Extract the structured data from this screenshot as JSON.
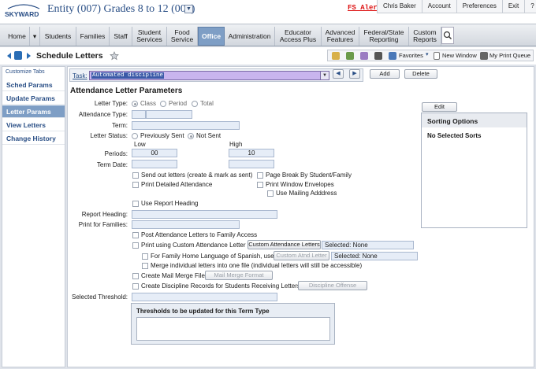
{
  "header": {
    "logo_text": "SKYWARD",
    "entity": "Entity (007) Grades 8 to 12 (007)",
    "fs_alert": "FS Alert",
    "user_links": [
      "Chris Baker",
      "Account",
      "Preferences",
      "Exit",
      "?"
    ]
  },
  "nav": {
    "items": [
      "Home",
      "Students",
      "Families",
      "Staff",
      "Student Services",
      "Food Service",
      "Office",
      "Administration",
      "Educator Access Plus",
      "Advanced Features",
      "Federal/State Reporting",
      "Custom Reports"
    ],
    "active": "Office"
  },
  "page": {
    "title": "Schedule Letters",
    "toolbar": {
      "favorites": "Favorites",
      "new_window": "New Window",
      "print_queue": "My Print Queue"
    }
  },
  "sidebar": {
    "customize": "Customize Tabs",
    "items": [
      "Sched Params",
      "Update Params",
      "Letter Params",
      "View Letters",
      "Change History"
    ],
    "active": "Letter Params"
  },
  "task": {
    "label": "Task:",
    "value": "Automated discipline",
    "add": "Add",
    "delete": "Delete"
  },
  "form": {
    "heading": "Attendance Letter Parameters",
    "letter_type_label": "Letter Type:",
    "letter_type_options": [
      "Class",
      "Period",
      "Total"
    ],
    "attendance_type_label": "Attendance Type:",
    "term_label": "Term:",
    "letter_status_label": "Letter Status:",
    "letter_status_options": [
      "Previously Sent",
      "Not Sent"
    ],
    "low_label": "Low",
    "high_label": "High",
    "periods_label": "Periods:",
    "periods_low": "00",
    "periods_high": "10",
    "term_date_label": "Term Date:",
    "send_out": "Send out letters (create & mark as sent)",
    "page_break": "Page Break By Student/Family",
    "print_detailed": "Print Detailed Attendance",
    "print_envelopes": "Print Window Envelopes",
    "use_mailing": "Use Mailing Adddress",
    "use_report_heading": "Use Report Heading",
    "report_heading_label": "Report Heading:",
    "print_for_families_label": "Print for Families:",
    "post_attendance": "Post Attendance Letters to Family Access",
    "print_custom": "Print using Custom Attendance Letter",
    "custom_btn": "Custom Attendance Letters",
    "custom_selected": "Selected: None",
    "spanish": "For Family Home Language of Spanish, use",
    "custom_atnd_btn": "Custom Atnd Letter",
    "spanish_selected": "Selected: None",
    "merge": "Merge individual letters into one file (individual letters will still be accessible)",
    "mail_merge": "Create Mail Merge File",
    "mail_merge_btn": "Mail Merge Format",
    "discipline": "Create Discipline Records for Students Receiving Letters",
    "discipline_btn": "Discipline Offense",
    "selected_threshold_label": "Selected Threshold:",
    "thresholds_title": "Thresholds to be updated for this Term Type"
  },
  "sorting": {
    "edit": "Edit",
    "title": "Sorting Options",
    "none": "No Selected Sorts"
  }
}
